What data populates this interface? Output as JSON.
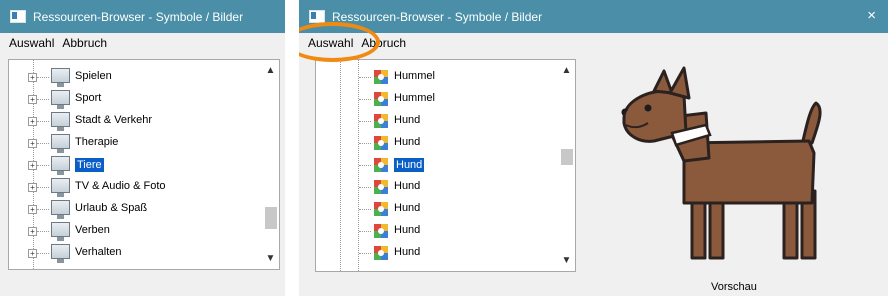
{
  "window1": {
    "title": "Ressourcen-Browser - Symbole / Bilder",
    "menu": [
      "Auswahl",
      "Abbruch"
    ],
    "tree_items": [
      {
        "label": "Spielen",
        "selected": false
      },
      {
        "label": "Sport",
        "selected": false
      },
      {
        "label": "Stadt & Verkehr",
        "selected": false
      },
      {
        "label": "Therapie",
        "selected": false
      },
      {
        "label": "Tiere",
        "selected": true
      },
      {
        "label": "TV & Audio & Foto",
        "selected": false
      },
      {
        "label": "Urlaub & Spaß",
        "selected": false
      },
      {
        "label": "Verben",
        "selected": false
      },
      {
        "label": "Verhalten",
        "selected": false
      }
    ],
    "scroll_position": 0.78
  },
  "window2": {
    "title": "Ressourcen-Browser - Symbole / Bilder",
    "menu": [
      "Auswahl",
      "Abbruch"
    ],
    "close_label": "×",
    "tree_items": [
      {
        "label": "Hummel",
        "selected": false
      },
      {
        "label": "Hummel",
        "selected": false
      },
      {
        "label": "Hund",
        "selected": false
      },
      {
        "label": "Hund",
        "selected": false
      },
      {
        "label": "Hund",
        "selected": true
      },
      {
        "label": "Hund",
        "selected": false
      },
      {
        "label": "Hund",
        "selected": false
      },
      {
        "label": "Hund",
        "selected": false
      },
      {
        "label": "Hund",
        "selected": false
      }
    ],
    "scroll_position": 0.5,
    "preview_label": "Vorschau",
    "highlight_color": "#f08a10"
  }
}
